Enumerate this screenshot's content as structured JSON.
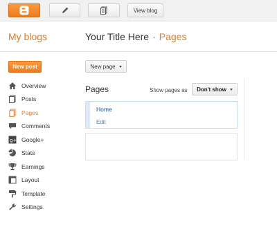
{
  "topbar": {
    "view_blog_label": "View blog"
  },
  "header": {
    "my_blogs": "My blogs",
    "blog_title": "Your Title Here",
    "separator": "·",
    "section": "Pages"
  },
  "sidebar": {
    "new_post_label": "New post",
    "items": [
      {
        "label": "Overview",
        "icon": "home-icon"
      },
      {
        "label": "Posts",
        "icon": "posts-icon"
      },
      {
        "label": "Pages",
        "icon": "pages-icon",
        "active": true
      },
      {
        "label": "Comments",
        "icon": "comments-icon"
      },
      {
        "label": "Google+",
        "icon": "google-plus-icon"
      },
      {
        "label": "Stats",
        "icon": "stats-icon"
      },
      {
        "label": "Earnings",
        "icon": "trophy-icon"
      },
      {
        "label": "Layout",
        "icon": "layout-icon"
      },
      {
        "label": "Template",
        "icon": "template-icon"
      },
      {
        "label": "Settings",
        "icon": "wrench-icon"
      }
    ]
  },
  "main": {
    "new_page_label": "New page",
    "heading": "Pages",
    "show_pages_as": "Show pages as",
    "show_option": "Don't show",
    "pages": [
      {
        "title": "Home",
        "action": "Edit"
      }
    ]
  },
  "colors": {
    "accent": "#e8792b",
    "link": "#1a4f9c"
  }
}
